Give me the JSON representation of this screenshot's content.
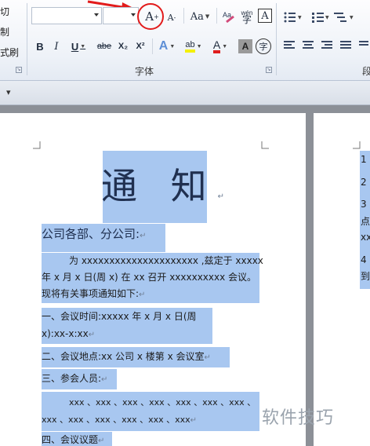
{
  "clipboard": {
    "items": [
      "切",
      "制",
      "式刷"
    ]
  },
  "font_group": {
    "label": "字体",
    "grow_font_label": "A",
    "grow_font_sup": "+",
    "shrink_font_label": "A",
    "shrink_font_sup": "-",
    "change_case_label": "Aa",
    "phonetic_label": "wén",
    "border_label": "A",
    "bold_label": "B",
    "italic_label": "I",
    "underline_label": "U",
    "strike_label": "abe",
    "subscript_label": "X₂",
    "superscript_label": "X²",
    "text_effect_label": "A",
    "highlight_label": "ab",
    "font_color_label": "A",
    "char_shading_label": "A",
    "enclose_label": "字"
  },
  "paragraph_group": {
    "label": "段"
  },
  "ruler": {
    "quick_access_glyph": "▾"
  },
  "document": {
    "title": "通 知",
    "salutation": "公司各部、分公司:",
    "body_line1": "为 xxxxxxxxxxxxxxxxxxxxx ,兹定于 xxxxx",
    "body_line2": "年 x 月 x 日(周 x) 在 xx 召开 xxxxxxxxxx 会议。",
    "body_line3": "现将有关事项通知如下:",
    "item1_line1": "一、会议时间:xxxxx 年 x 月 x 日(周",
    "item1_line2": "x):xx-x:xx",
    "item2": "二、会议地点:xx 公司 x 楼第 x 会议室",
    "item3": "三、参会人员:",
    "attendees_line1": "xxx 、xxx 、xxx 、xxx 、xxx 、xxx 、xxx 、",
    "attendees_line2": "xxx 、xxx 、xxx 、xxx 、xxx 、xxx",
    "item4": "四、会议议题"
  },
  "page2": {
    "lines": [
      "1",
      "2",
      "3",
      "点",
      "xx",
      "4",
      "到"
    ]
  },
  "watermark": "软件技巧",
  "colors": {
    "selection": "#a8c7f0",
    "annotation_red": "#e21b1b",
    "workspace": "#8c9097"
  }
}
